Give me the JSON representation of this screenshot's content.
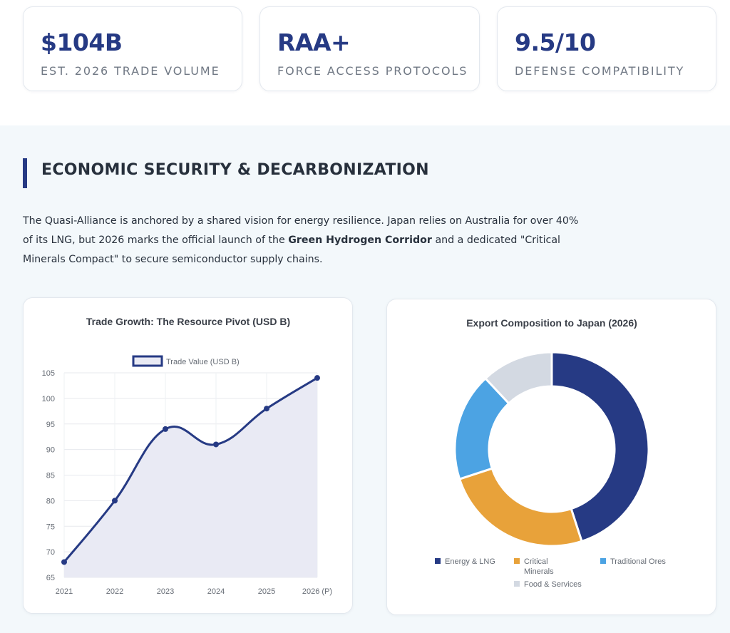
{
  "stats": [
    {
      "value": "$104B",
      "label": "EST. 2026 TRADE VOLUME"
    },
    {
      "value": "RAA+",
      "label": "FORCE ACCESS PROTOCOLS"
    },
    {
      "value": "9.5/10",
      "label": "DEFENSE COMPATIBILITY"
    }
  ],
  "section": {
    "title": "ECONOMIC SECURITY & DECARBONIZATION",
    "intro_1": "The Quasi-Alliance is anchored by a shared vision for energy resilience. Japan relies on Australia for over 40% of its LNG, but 2026 marks the official launch of the ",
    "intro_bold": "Green Hydrogen Corridor",
    "intro_2": " and a dedicated \"Critical Minerals Compact\" to secure semiconductor supply chains."
  },
  "colors": {
    "navy": "#263a84",
    "orange": "#e8a23a",
    "blue": "#4ca3e3",
    "grey": "#d3d9e2",
    "area_fill": "#e9eaf4"
  },
  "chart_data": [
    {
      "type": "area",
      "title": "Trade Growth: The Resource Pivot (USD B)",
      "categories": [
        "2021",
        "2022",
        "2023",
        "2024",
        "2025",
        "2026 (P)"
      ],
      "series": [
        {
          "name": "Trade Value (USD B)",
          "values": [
            68,
            80,
            94,
            91,
            98,
            104
          ]
        }
      ],
      "ylim": [
        65,
        105
      ],
      "yticks": [
        65,
        70,
        75,
        80,
        85,
        90,
        95,
        100,
        105
      ],
      "grid": true,
      "legend": "top"
    },
    {
      "type": "pie",
      "title": "Export Composition to Japan (2026)",
      "labels": [
        "Energy & LNG",
        "Critical Minerals",
        "Traditional Ores",
        "Food & Services"
      ],
      "values": [
        45,
        25,
        18,
        12
      ],
      "legend": "bottom"
    }
  ]
}
